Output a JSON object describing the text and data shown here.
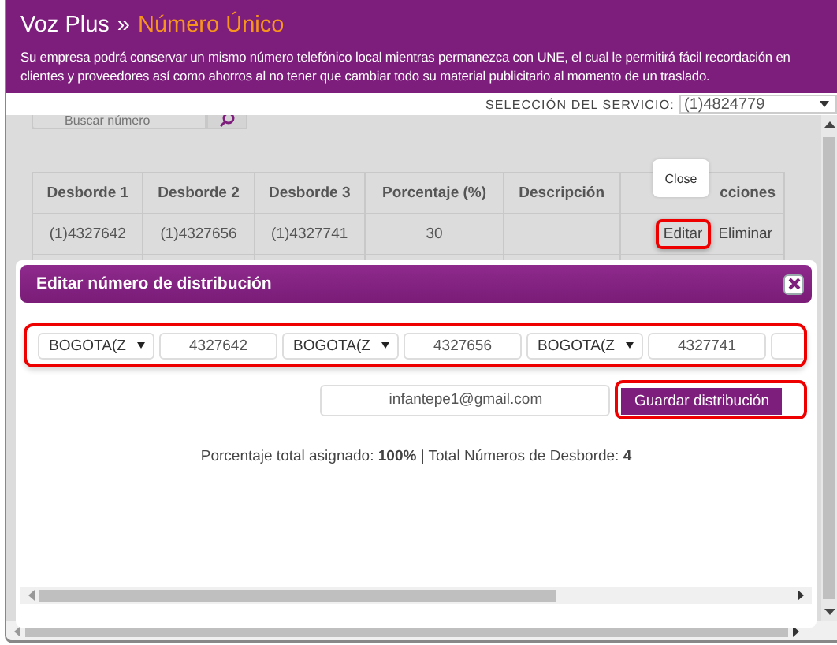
{
  "header": {
    "section": "Voz Plus",
    "separator": "»",
    "page": "Número Único",
    "description": "Su empresa podrá conservar un mismo número telefónico local mientras permanezca con UNE, el cual le permitirá fácil recordación en clientes y proveedores así como ahorros al no tener que cambiar todo su material publicitario al momento de un traslado."
  },
  "service_selector": {
    "label": "SELECCIÓN DEL SERVICIO:",
    "value": "(1)4824779"
  },
  "search": {
    "placeholder": "Buscar número"
  },
  "table": {
    "columns": [
      "Desborde 1",
      "Desborde 2",
      "Desborde 3",
      "Porcentaje (%)",
      "Descripción",
      "cciones"
    ],
    "rows": [
      {
        "cells": [
          "(1)4327642",
          "(1)4327656",
          "(1)4327741",
          "30",
          ""
        ],
        "actions": [
          {
            "label": "Editar",
            "highlighted": true
          },
          {
            "label": "Eliminar",
            "highlighted": false
          }
        ]
      }
    ]
  },
  "tooltip": {
    "text": "Close"
  },
  "dialog": {
    "title": "Editar número de distribución",
    "numbers_highlighted": true,
    "numbers": [
      {
        "kind": "select",
        "value": "BOGOTA(Z"
      },
      {
        "kind": "input",
        "value": "4327642"
      },
      {
        "kind": "select",
        "value": "BOGOTA(Z"
      },
      {
        "kind": "input",
        "value": "4327656"
      },
      {
        "kind": "select",
        "value": "BOGOTA(Z"
      },
      {
        "kind": "input",
        "value": "4327741"
      }
    ],
    "email": {
      "value": "infantepe1@gmail.com"
    },
    "save_button": {
      "label": "Guardar distribución",
      "highlighted": true
    },
    "summary": "Porcentaje total asignado: **100%** | Total Números de Desborde: **4**"
  }
}
